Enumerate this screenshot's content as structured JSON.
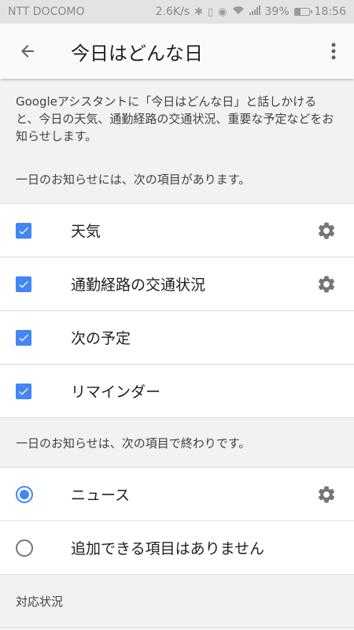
{
  "status": {
    "carrier": "NTT DOCOMO",
    "speed": "2.6K/s",
    "battery": "39%",
    "time": "18:56"
  },
  "appbar": {
    "title": "今日はどんな日"
  },
  "intro": {
    "text": "Googleアシスタントに「今日はどんな日」と話しかけると、今日の天気、通勤経路の交通状況、重要な予定などをお知らせします。"
  },
  "section_start": {
    "label": "一日のお知らせには、次の項目があります。",
    "items": [
      {
        "label": "天気",
        "checked": true,
        "settings": true
      },
      {
        "label": "通勤経路の交通状況",
        "checked": true,
        "settings": true
      },
      {
        "label": "次の予定",
        "checked": true,
        "settings": false
      },
      {
        "label": "リマインダー",
        "checked": true,
        "settings": false
      }
    ]
  },
  "section_end": {
    "label": "一日のお知らせは、次の項目で終わりです。",
    "items": [
      {
        "label": "ニュース",
        "selected": true,
        "settings": true
      },
      {
        "label": "追加できる項目はありません",
        "selected": false,
        "settings": false
      }
    ]
  },
  "support": {
    "label": "対応状況"
  },
  "colors": {
    "accent": "#4285f4",
    "gear": "#757575"
  }
}
